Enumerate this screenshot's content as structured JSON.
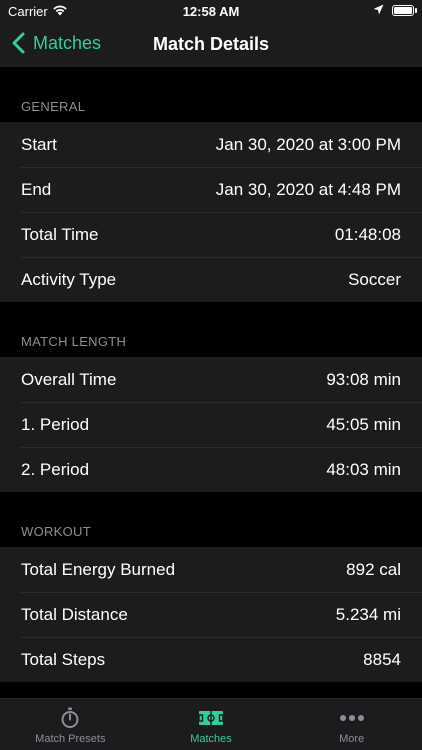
{
  "status_bar": {
    "carrier": "Carrier",
    "time": "12:58 AM"
  },
  "nav": {
    "back_label": "Matches",
    "title": "Match Details"
  },
  "sections": {
    "general": {
      "header": "GENERAL",
      "rows": [
        {
          "label": "Start",
          "value": "Jan 30, 2020 at 3:00 PM"
        },
        {
          "label": "End",
          "value": "Jan 30, 2020 at 4:48 PM"
        },
        {
          "label": "Total Time",
          "value": "01:48:08"
        },
        {
          "label": "Activity Type",
          "value": "Soccer"
        }
      ]
    },
    "match_length": {
      "header": "MATCH LENGTH",
      "rows": [
        {
          "label": "Overall Time",
          "value": "93:08 min"
        },
        {
          "label": "1. Period",
          "value": "45:05 min"
        },
        {
          "label": "2. Period",
          "value": "48:03 min"
        }
      ]
    },
    "workout": {
      "header": "WORKOUT",
      "rows": [
        {
          "label": "Total Energy Burned",
          "value": "892 cal"
        },
        {
          "label": "Total Distance",
          "value": "5.234 mi"
        },
        {
          "label": "Total Steps",
          "value": "8854"
        }
      ]
    }
  },
  "tab_bar": {
    "tabs": [
      {
        "label": "Match Presets",
        "icon": "stopwatch-icon"
      },
      {
        "label": "Matches",
        "icon": "soccer-field-icon"
      },
      {
        "label": "More",
        "icon": "more-dots-icon"
      }
    ],
    "active_color": "#2fd19a"
  }
}
